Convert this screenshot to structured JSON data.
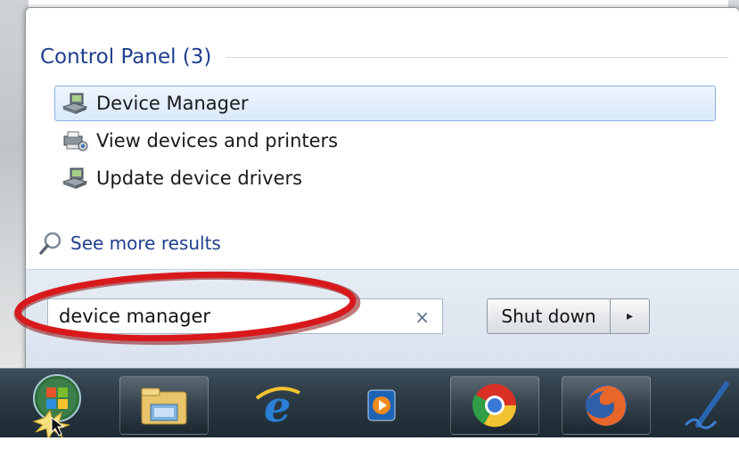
{
  "section": {
    "title": "Control Panel (3)"
  },
  "results": [
    {
      "label": "Device Manager",
      "icon": "device-manager-icon",
      "selected": true
    },
    {
      "label": "View devices and printers",
      "icon": "devices-printers-icon",
      "selected": false
    },
    {
      "label": "Update device drivers",
      "icon": "device-manager-icon",
      "selected": false
    }
  ],
  "see_more": {
    "label": "See more results",
    "icon": "magnifier-icon"
  },
  "search": {
    "value": "device manager",
    "clear_glyph": "×"
  },
  "shutdown": {
    "label": "Shut down",
    "arrow_glyph": "▸"
  },
  "taskbar": {
    "items": [
      "start-orb-icon",
      "windows-explorer-icon",
      "internet-explorer-icon",
      "media-player-icon",
      "chrome-icon",
      "firefox-icon",
      "pen-app-icon"
    ]
  },
  "colors": {
    "annotation": "#d8191c",
    "link": "#1e3f8e",
    "highlight_border": "#8db2e3"
  }
}
